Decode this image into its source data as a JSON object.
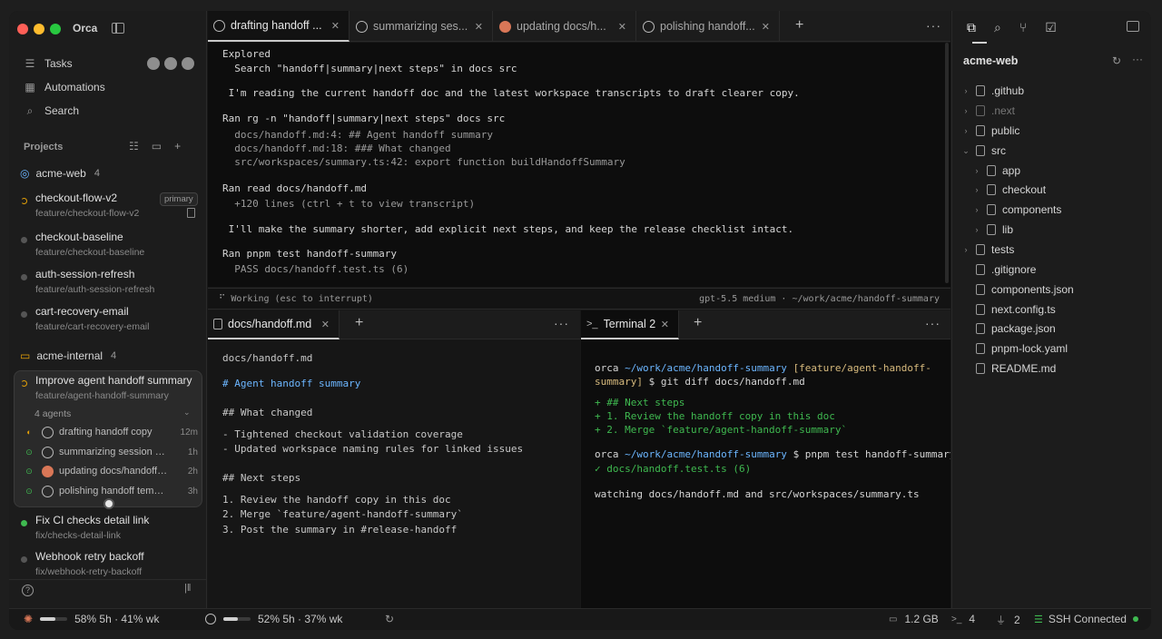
{
  "app": {
    "name": "Orca"
  },
  "sidebar": {
    "nav": [
      {
        "label": "Tasks",
        "icon": "list-icon"
      },
      {
        "label": "Automations",
        "icon": "calendar-icon"
      },
      {
        "label": "Search",
        "icon": "search-icon"
      }
    ],
    "projects_title": "Projects",
    "repos": [
      {
        "name": "acme-web",
        "count": "4"
      },
      {
        "name": "acme-internal",
        "count": "4"
      }
    ],
    "workspaces": [
      {
        "name": "checkout-flow-v2",
        "branch": "feature/checkout-flow-v2",
        "badge": "primary"
      },
      {
        "name": "checkout-baseline",
        "branch": "feature/checkout-baseline"
      },
      {
        "name": "auth-session-refresh",
        "branch": "feature/auth-session-refresh"
      },
      {
        "name": "cart-recovery-email",
        "branch": "feature/cart-recovery-email"
      },
      {
        "name": "Improve agent handoff summary",
        "branch": "feature/agent-handoff-summary"
      },
      {
        "name": "Fix CI checks detail link",
        "branch": "fix/checks-detail-link"
      },
      {
        "name": "Webhook retry backoff",
        "branch": "fix/webhook-retry-backoff"
      }
    ],
    "agents_label": "4 agents",
    "agents": [
      {
        "name": "drafting handoff copy",
        "time": "12m"
      },
      {
        "name": "summarizing session co...",
        "time": "1h"
      },
      {
        "name": "updating docs/handoff....",
        "time": "2h"
      },
      {
        "name": "polishing handoff templ...",
        "time": "3h"
      }
    ]
  },
  "tabs": [
    "drafting handoff ...",
    "summarizing ses...",
    "updating docs/h...",
    "polishing handoff..."
  ],
  "terminal1": {
    "lines": [
      "Explored",
      "  Search \"handoff|summary|next steps\" in docs src",
      " I'm reading the current handoff doc and the latest workspace transcripts to draft clearer copy.",
      "Ran rg -n \"handoff|summary|next steps\" docs src",
      "  docs/handoff.md:4: ## Agent handoff summary",
      "  docs/handoff.md:18: ### What changed",
      "  src/workspaces/summary.ts:42: export function buildHandoffSummary",
      "Ran read docs/handoff.md",
      "  +120 lines (ctrl + t to view transcript)",
      " I'll make the summary shorter, add explicit next steps, and keep the release checklist intact.",
      "Ran pnpm test handoff-summary",
      "  PASS docs/handoff.test.ts (6)"
    ],
    "status_left": "Working (esc to interrupt)",
    "status_right": "gpt-5.5 medium · ~/work/acme/handoff-summary"
  },
  "editor": {
    "tab": "docs/handoff.md",
    "lines": [
      "docs/handoff.md",
      "# Agent handoff summary",
      "## What changed",
      "- Tightened checkout validation coverage",
      "- Updated workspace naming rules for linked issues",
      "## Next steps",
      "1. Review the handoff copy in this doc",
      "2. Merge `feature/agent-handoff-summary`",
      "3. Post the summary in #release-handoff"
    ]
  },
  "terminal2": {
    "tab": "Terminal 2",
    "prompt_user": "orca",
    "prompt_path": "~/work/acme/handoff-summary",
    "prompt_branch": "[feature/agent-handoff-",
    "prompt_branch2": "summary]",
    "cmd1": "$ git diff docs/handoff.md",
    "diff": [
      "+ ## Next steps",
      "+ 1. Review the handoff copy in this doc",
      "+ 2. Merge `feature/agent-handoff-summary`"
    ],
    "cmd2": "$ pnpm test handoff-summary",
    "pass": "✓ docs/handoff.test.ts (6)",
    "watch": "watching docs/handoff.md and src/workspaces/summary.ts"
  },
  "explorer": {
    "title": "acme-web",
    "items": [
      ".github",
      ".next",
      "public",
      "src",
      "app",
      "checkout",
      "components",
      "lib",
      "tests",
      ".gitignore",
      "components.json",
      "next.config.ts",
      "package.json",
      "pnpm-lock.yaml",
      "README.md"
    ]
  },
  "statusbar": {
    "claude": "58% 5h · 41% wk",
    "claude_fill": 0.58,
    "openai": "52% 5h · 37% wk",
    "openai_fill": 0.52,
    "memory": "1.2 GB",
    "terminals": "4",
    "ports": "2",
    "ssh": "SSH Connected"
  }
}
